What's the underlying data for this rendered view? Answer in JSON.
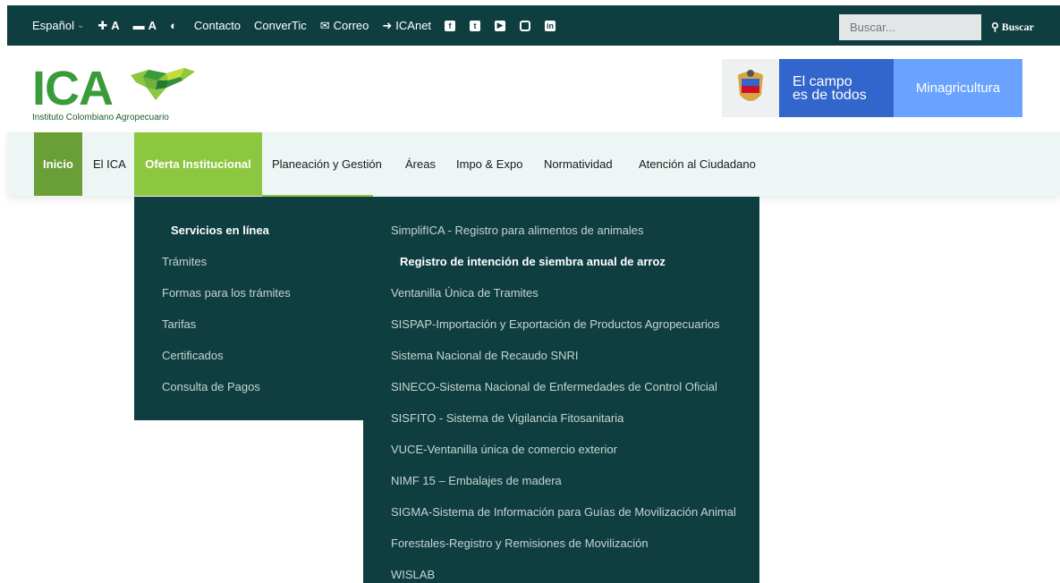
{
  "topbar": {
    "language": "Español",
    "font_up": "A",
    "font_down": "A",
    "contact": "Contacto",
    "convertic": "ConverTic",
    "mail": "Correo",
    "icanet": "ICAnet",
    "social_icons": [
      "facebook-icon",
      "twitter-icon",
      "youtube-icon",
      "instagram-icon",
      "linkedin-icon"
    ],
    "search_placeholder": "Buscar...",
    "search_button": "Buscar"
  },
  "header": {
    "logo_text": "ICA",
    "logo_subtitle": "Instituto Colombiano Agropecuario",
    "gov_campo_line1": "El campo",
    "gov_campo_line2": "es de todos",
    "gov_ministry": "Minagricultura"
  },
  "nav": {
    "items": [
      {
        "label": "Inicio"
      },
      {
        "label": "El ICA"
      },
      {
        "label": "Oferta Institucional"
      },
      {
        "label": "Planeación y Gestión"
      },
      {
        "label": "Áreas"
      },
      {
        "label": "Impo & Expo"
      },
      {
        "label": "Normatividad"
      },
      {
        "label": "Atención al Ciudadano"
      }
    ]
  },
  "dropdown": {
    "left": [
      {
        "label": "Servicios en línea"
      },
      {
        "label": "Trámites"
      },
      {
        "label": "Formas para los trámites"
      },
      {
        "label": "Tarifas"
      },
      {
        "label": "Certificados"
      },
      {
        "label": "Consulta de Pagos"
      }
    ],
    "right": [
      {
        "label": "SimplifICA - Registro para alimentos de animales"
      },
      {
        "label": "Registro de intención de siembra anual de arroz"
      },
      {
        "label": "Ventanilla Única de Tramites"
      },
      {
        "label": "SISPAP-Importación y Exportación de Productos Agropecuarios"
      },
      {
        "label": "Sistema Nacional de Recaudo SNRI"
      },
      {
        "label": "SINECO-Sistema Nacional de Enfermedades de Control Oficial"
      },
      {
        "label": "SISFITO - Sistema de Vigilancia Fitosanitaria"
      },
      {
        "label": "VUCE-Ventanilla única de comercio exterior"
      },
      {
        "label": "NIMF 15 – Embalajes de madera"
      },
      {
        "label": "SIGMA-Sistema de Información para Guías de Movilización Animal"
      },
      {
        "label": "Forestales-Registro y Remisiones de Movilización"
      },
      {
        "label": "WISLAB"
      }
    ]
  },
  "colors": {
    "dark_teal": "#0f3e40",
    "green": "#8dc63f",
    "dark_green": "#6a9f38",
    "gov_blue": "#3366cc",
    "gov_light_blue": "#69a3ff"
  }
}
